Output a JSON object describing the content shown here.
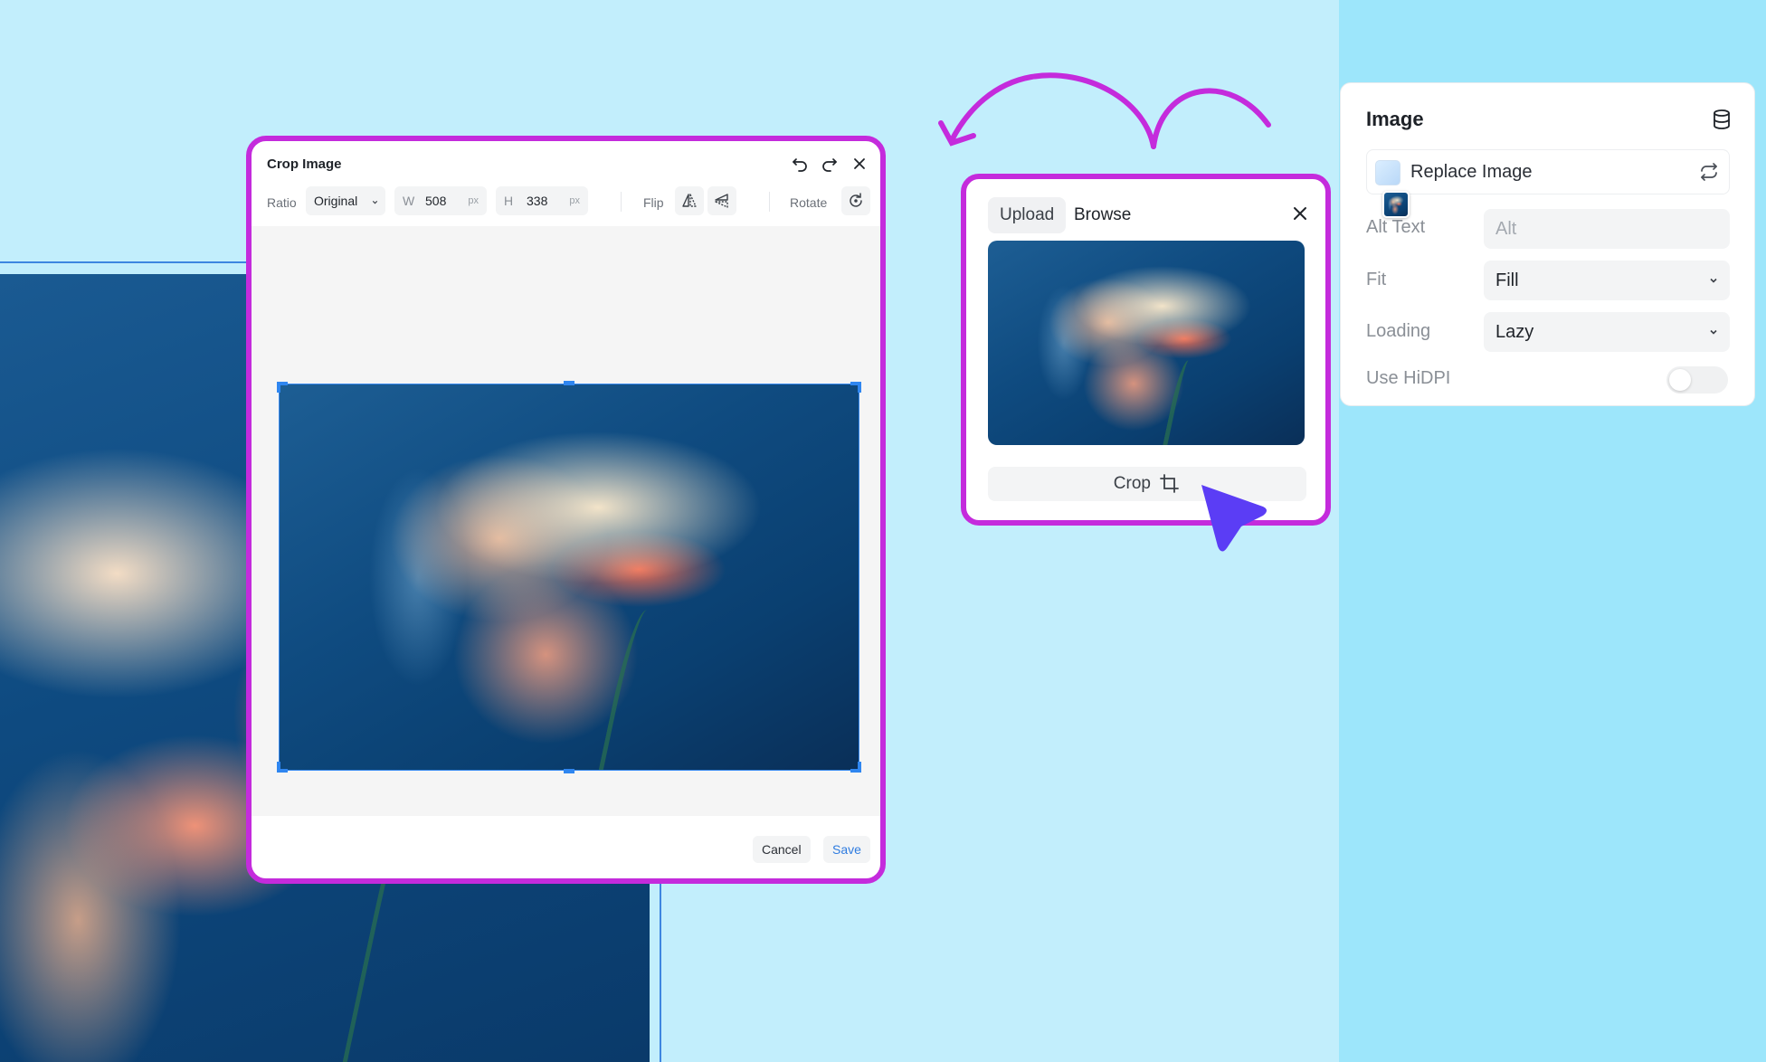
{
  "crop_dialog": {
    "title": "Crop Image",
    "ratio_label": "Ratio",
    "ratio_value": "Original",
    "width_key": "W",
    "width_value": "508",
    "width_unit": "px",
    "height_key": "H",
    "height_value": "338",
    "height_unit": "px",
    "flip_label": "Flip",
    "rotate_label": "Rotate",
    "cancel_label": "Cancel",
    "save_label": "Save",
    "icons": [
      "undo-icon",
      "redo-icon",
      "close-icon",
      "flip-horizontal-icon",
      "flip-vertical-icon",
      "rotate-icon"
    ]
  },
  "popover": {
    "tabs": [
      {
        "label": "Upload",
        "active": true
      },
      {
        "label": "Browse",
        "active": false
      }
    ],
    "crop_label": "Crop",
    "icons": [
      "close-icon",
      "crop-icon"
    ]
  },
  "properties": {
    "title": "Image",
    "replace_label": "Replace Image",
    "alt_label": "Alt Text",
    "alt_placeholder": "Alt",
    "fit_label": "Fit",
    "fit_value": "Fill",
    "loading_label": "Loading",
    "loading_value": "Lazy",
    "hidpi_label": "Use HiDPI",
    "hidpi_enabled": false,
    "icons": [
      "database-icon",
      "swap-icon",
      "chevron-down-icon"
    ]
  },
  "colors": {
    "background": "#c2eefc",
    "sidebar": "#9de6fb",
    "highlight_border": "#c42bdc",
    "cursor": "#5b3df5",
    "selection": "#2f86f0",
    "save_text": "#2f7ce0"
  }
}
